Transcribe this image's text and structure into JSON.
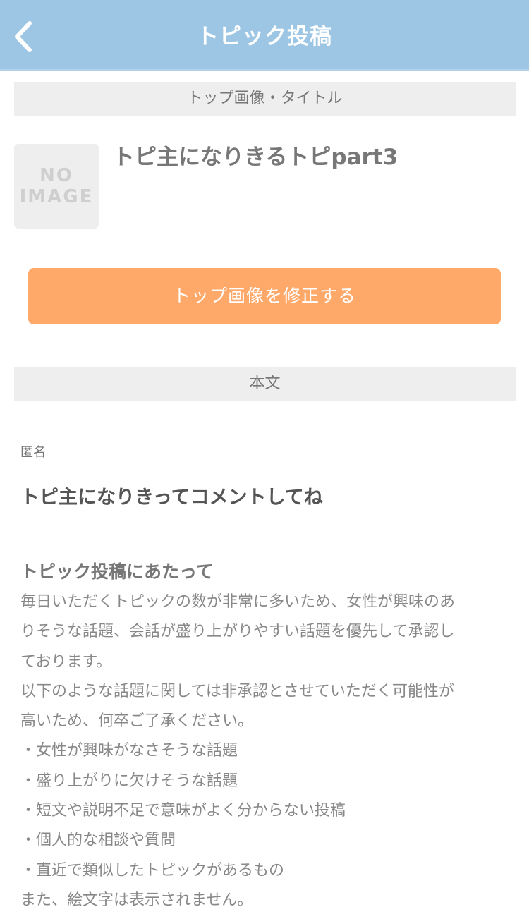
{
  "header": {
    "title": "トピック投稿",
    "back_icon": "chevron-left-icon",
    "background": "#9dc6e4"
  },
  "section_top": {
    "label": "トップ画像・タイトル"
  },
  "thumbnail": {
    "line1": "NO",
    "line2": "IMAGE"
  },
  "topic": {
    "title": "トピ主になりきるトピpart3"
  },
  "edit_button": {
    "label": "トップ画像を修正する",
    "color": "#fea96a"
  },
  "section_body": {
    "label": "本文"
  },
  "post": {
    "author": "匿名",
    "text": "トピ主になりきってコメントしてね"
  },
  "guidelines": {
    "heading": "トピック投稿にあたって",
    "lines": [
      "毎日いただくトピックの数が非常に多いため、女性が興味のあ",
      "りそうな話題、会話が盛り上がりやすい話題を優先して承認し",
      "ております。",
      "以下のような話題に関しては非承認とさせていただく可能性が",
      "高いため、何卒ご了承ください。",
      "・女性が興味がなさそうな話題",
      "・盛り上がりに欠けそうな話題",
      "・短文や説明不足で意味がよく分からない投稿",
      "・個人的な相談や質問",
      "・直近で類似したトピックがあるもの",
      "また、絵文字は表示されません。"
    ]
  }
}
